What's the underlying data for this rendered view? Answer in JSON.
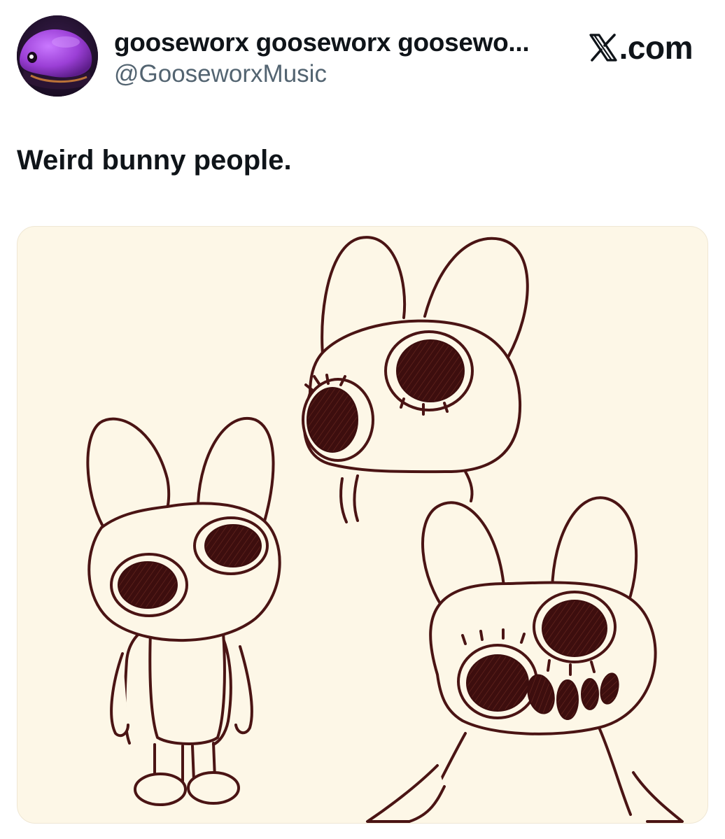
{
  "tweet": {
    "display_name": "gooseworx gooseworx goosewo...",
    "handle": "@GooseworxMusic",
    "source_label": ".com",
    "text": "Weird bunny people."
  },
  "icons": {
    "source": "x-logo-icon",
    "avatar": "purple-creature-avatar"
  },
  "colors": {
    "text_primary": "#0f1419",
    "text_secondary": "#536471",
    "image_background": "#fdf7e7",
    "drawing_line": "#4a1414",
    "drawing_eye_fill": "#3d0e0e",
    "avatar_purple": "#9b3fd6"
  }
}
